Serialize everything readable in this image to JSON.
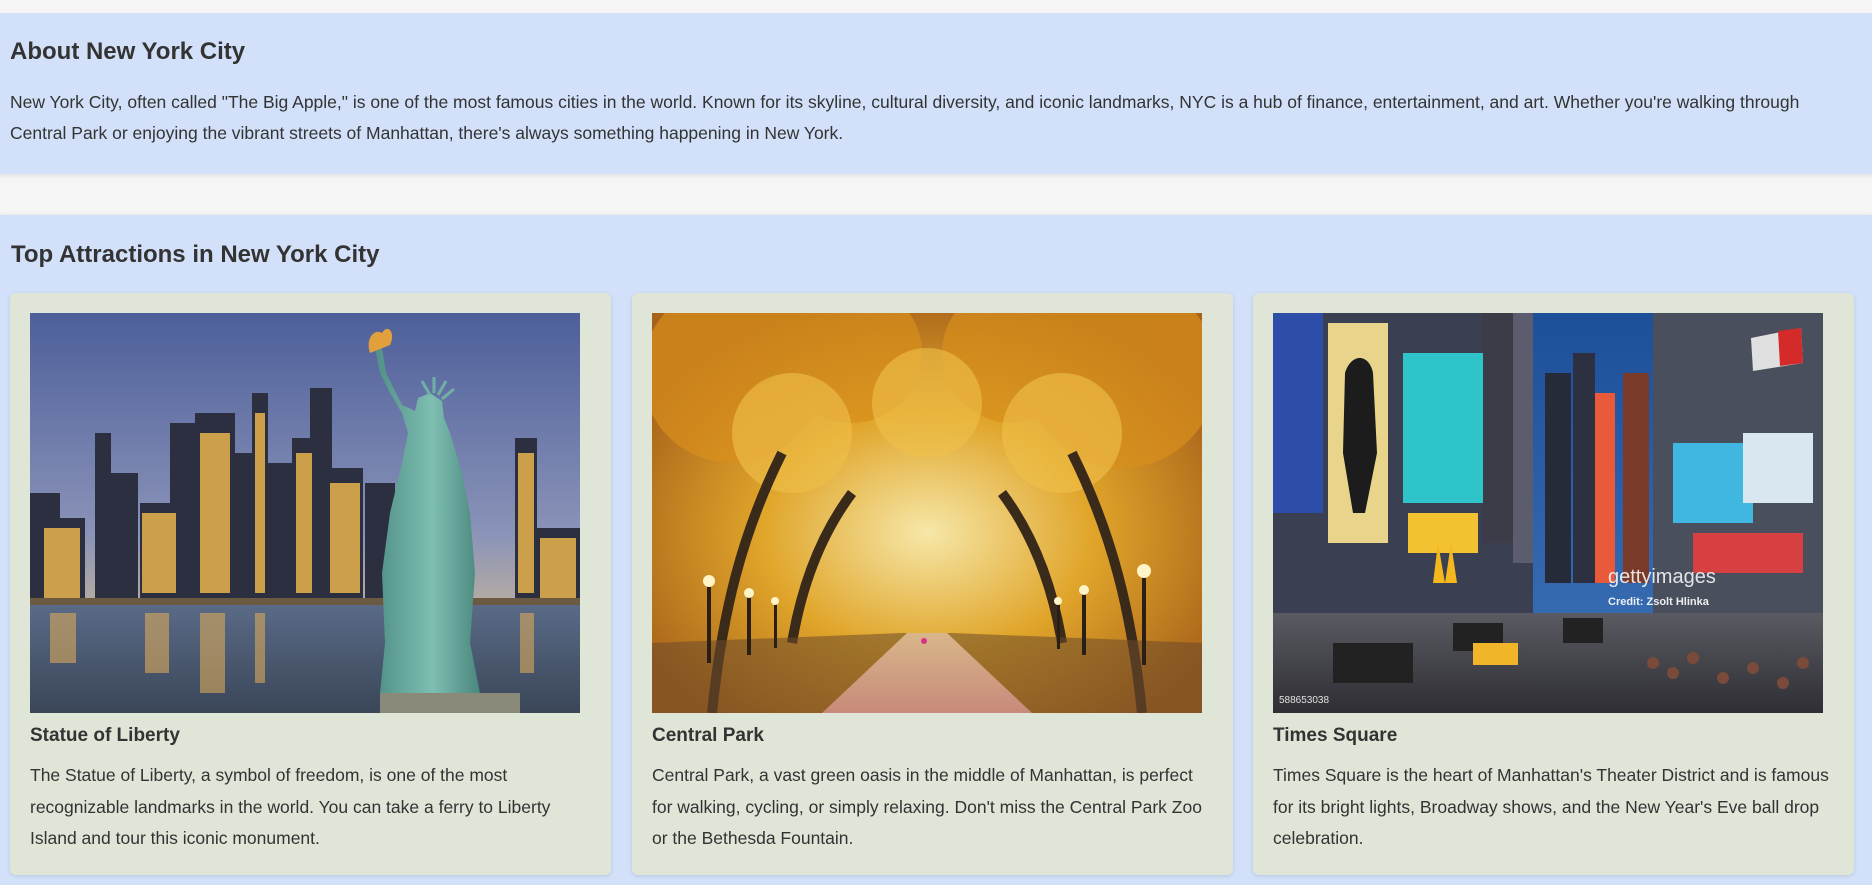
{
  "about": {
    "heading": "About New York City",
    "body": "New York City, often called \"The Big Apple,\" is one of the most famous cities in the world. Known for its skyline, cultural diversity, and iconic landmarks, NYC is a hub of finance, entertainment, and art. Whether you're walking through Central Park or enjoying the vibrant streets of Manhattan, there's always something happening in New York."
  },
  "attractions": {
    "heading": "Top Attractions in New York City",
    "cards": [
      {
        "title": "Statue of Liberty",
        "description": "The Statue of Liberty, a symbol of freedom, is one of the most recognizable landmarks in the world. You can take a ferry to Liberty Island and tour this iconic monument.",
        "image_icon": "statue-of-liberty-photo"
      },
      {
        "title": "Central Park",
        "description": "Central Park, a vast green oasis in the middle of Manhattan, is perfect for walking, cycling, or simply relaxing. Don't miss the Central Park Zoo or the Bethesda Fountain.",
        "image_icon": "central-park-photo"
      },
      {
        "title": "Times Square",
        "description": "Times Square is the heart of Manhattan's Theater District and is famous for its bright lights, Broadway shows, and the New Year's Eve ball drop celebration.",
        "image_icon": "times-square-photo",
        "watermark": "gettyimages",
        "credit": "Credit: Zsolt Hlinka",
        "image_id": "588653038"
      }
    ]
  },
  "colors": {
    "section_bg": "#d2e1f9",
    "card_bg": "#dfe6d8",
    "page_bg": "#f5f5f5",
    "text": "#333333"
  }
}
